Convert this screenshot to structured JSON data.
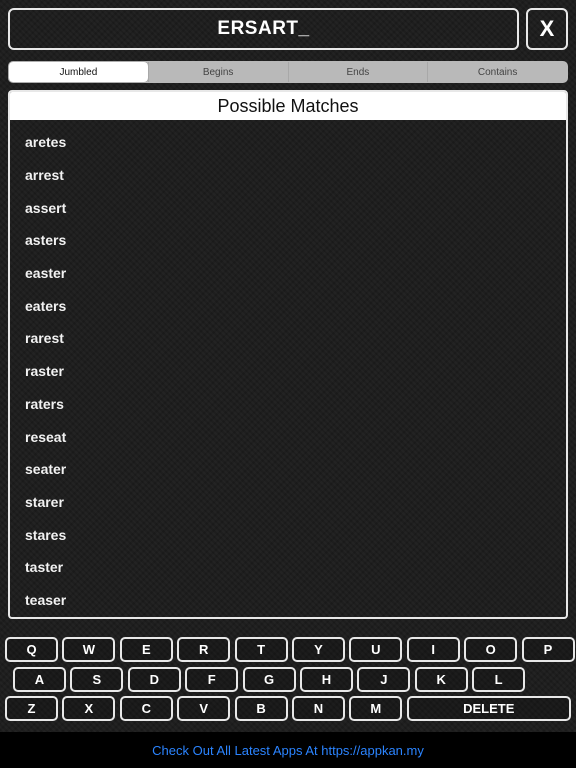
{
  "input": {
    "value": "ERSART_"
  },
  "close_button": {
    "label": "X"
  },
  "tabs": [
    {
      "label": "Jumbled",
      "active": true
    },
    {
      "label": "Begins",
      "active": false
    },
    {
      "label": "Ends",
      "active": false
    },
    {
      "label": "Contains",
      "active": false
    }
  ],
  "results": {
    "header": "Possible Matches",
    "items": [
      "aretes",
      "arrest",
      "assert",
      "asters",
      "easter",
      "eaters",
      "rarest",
      "raster",
      "raters",
      "reseat",
      "seater",
      "starer",
      "stares",
      "taster",
      "teaser"
    ]
  },
  "keyboard": {
    "row1": [
      "Q",
      "W",
      "E",
      "R",
      "T",
      "Y",
      "U",
      "I",
      "O",
      "P"
    ],
    "row2": [
      "A",
      "S",
      "D",
      "F",
      "G",
      "H",
      "J",
      "K",
      "L"
    ],
    "row3": [
      "Z",
      "X",
      "C",
      "V",
      "B",
      "N",
      "M"
    ],
    "delete_label": "DELETE"
  },
  "footer": {
    "text": "Check Out All Latest Apps At https://appkan.my"
  },
  "colors": {
    "accent_link": "#2b84ff",
    "border": "#e8e8e8",
    "background": "#1c1c1c"
  }
}
